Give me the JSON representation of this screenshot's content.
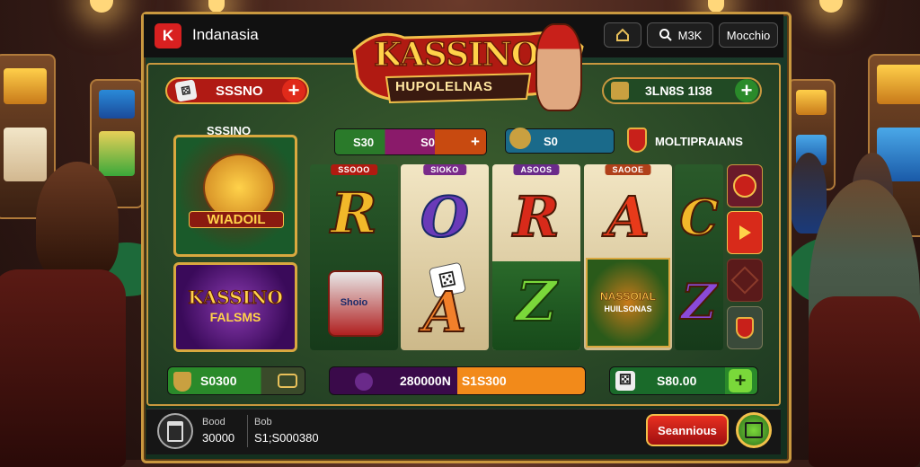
{
  "app": {
    "brand_letters": "K",
    "region": "Indanasia"
  },
  "topbar": {
    "home_icon": "home-icon",
    "search_icon": "search-icon",
    "search_label": "M3K",
    "mode_label": "Mocchio"
  },
  "logo": {
    "line1": "KASSINO",
    "line2": "HUPOLELNAS"
  },
  "left_pill": {
    "label": "SSSNO"
  },
  "right_pill": {
    "label": "3LN8S 1I38"
  },
  "sidebar": {
    "header": "SSSINO",
    "tile1_label": "WIADOIL",
    "tile2_line1": "KASSINO",
    "tile2_line2": "FALSMS"
  },
  "stats": {
    "a": "S30",
    "b": "S0",
    "c": "S0",
    "multiplier_label": "MOLTIPRAIANS"
  },
  "reels": [
    {
      "head": "SSOOO",
      "top": "R",
      "bottom": "",
      "bottom_badge": "Shoio"
    },
    {
      "head": "SIOKO",
      "top": "O",
      "bottom": "A"
    },
    {
      "head": "ASOOS",
      "top": "R",
      "bottom": "Z"
    },
    {
      "head": "SAOOE",
      "top": "A",
      "bottom_badge_line1": "NASSOIAL",
      "bottom_badge_line2": "HUILSONAS"
    },
    {
      "head": "",
      "top": "C",
      "bottom": "Z"
    }
  ],
  "bottom_bars": {
    "balance": "S0300",
    "bet_left": "280000N",
    "bet_right": "S1S300",
    "win": "S80.00"
  },
  "footer": {
    "label1": "Bood",
    "value1": "30000",
    "label2": "Bob",
    "value2": "S1;S000380",
    "spin_label": "Seannious"
  },
  "colors": {
    "gold": "#c9983f",
    "red": "#c8201a",
    "green": "#2a8a2a",
    "purple": "#5a1a6a"
  }
}
